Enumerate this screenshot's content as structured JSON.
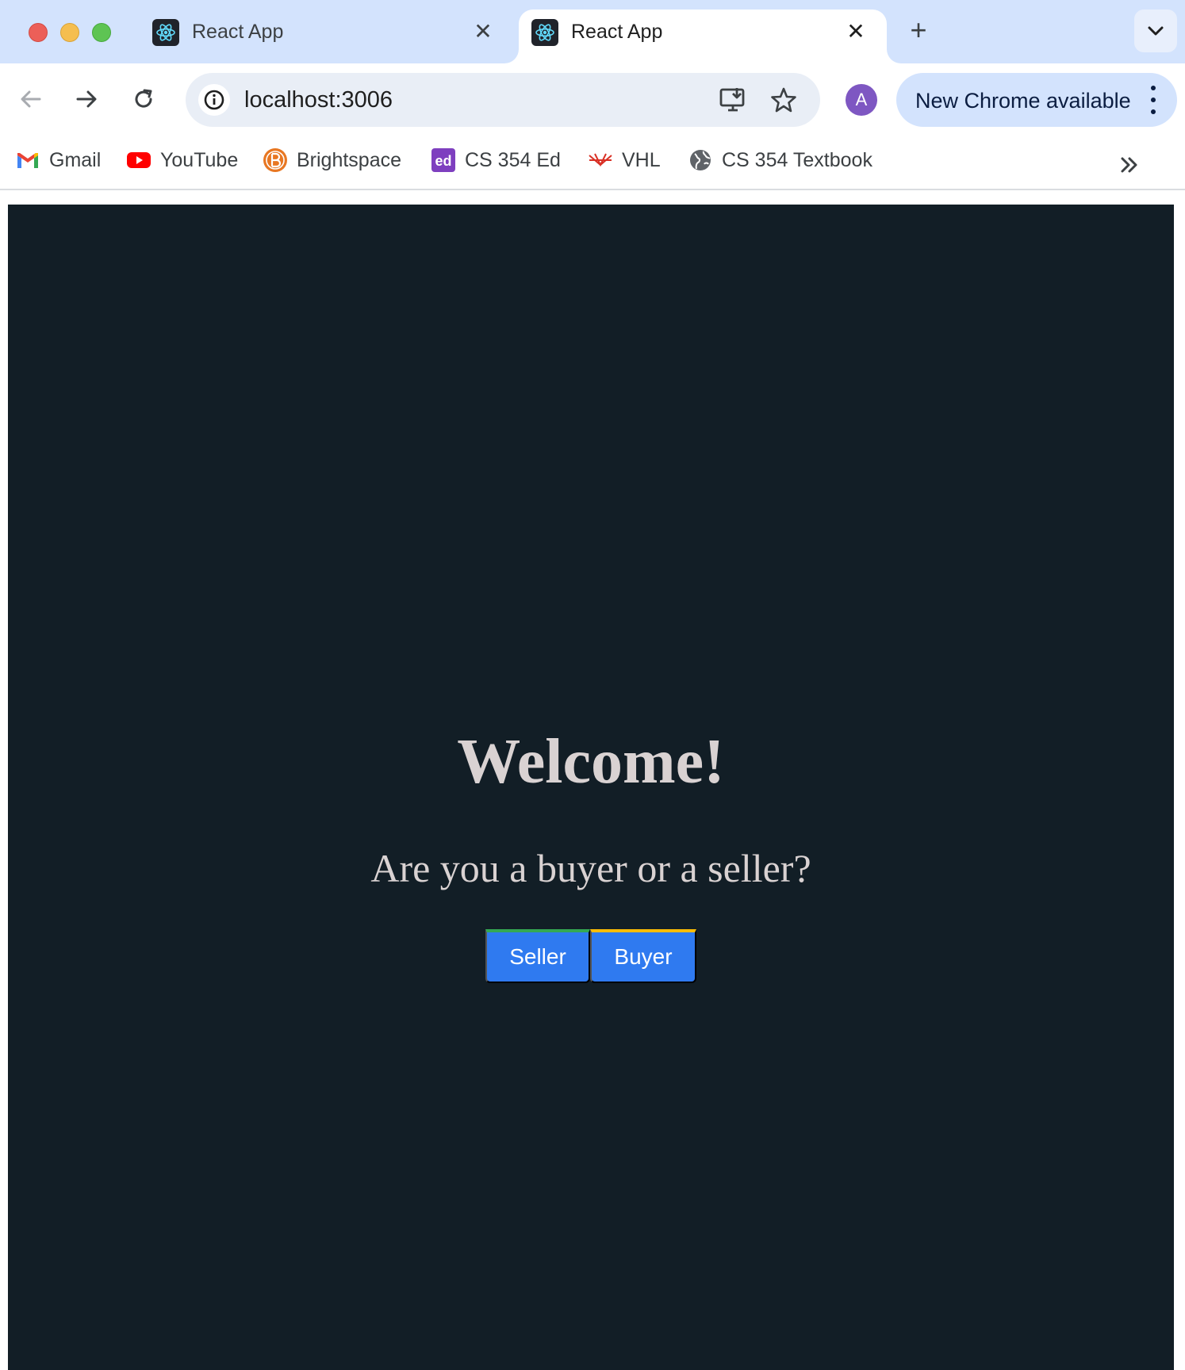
{
  "browser": {
    "tabs": [
      {
        "title": "React App",
        "active": false
      },
      {
        "title": "React App",
        "active": true
      }
    ],
    "close_glyph": "✕",
    "new_tab_glyph": "+",
    "url": "localhost:3006",
    "profile_initial": "A",
    "update_label": "New Chrome available",
    "bookmarks": [
      {
        "label": "Gmail",
        "icon": "gmail-icon"
      },
      {
        "label": "YouTube",
        "icon": "youtube-icon"
      },
      {
        "label": "Brightspace",
        "icon": "brightspace-icon"
      },
      {
        "label": "CS 354 Ed",
        "icon": "ed-icon"
      },
      {
        "label": "VHL",
        "icon": "vhl-icon"
      },
      {
        "label": "CS 354 Textbook",
        "icon": "globe-icon"
      }
    ]
  },
  "page": {
    "heading": "Welcome!",
    "question": "Are you a buyer or a seller?",
    "buttons": {
      "seller": "Seller",
      "buyer": "Buyer"
    }
  },
  "colors": {
    "page_background": "#121e26",
    "heading_text": "#d9d2d2",
    "button_blue": "#2f7af0",
    "tab_strip": "#d3e3fd"
  }
}
